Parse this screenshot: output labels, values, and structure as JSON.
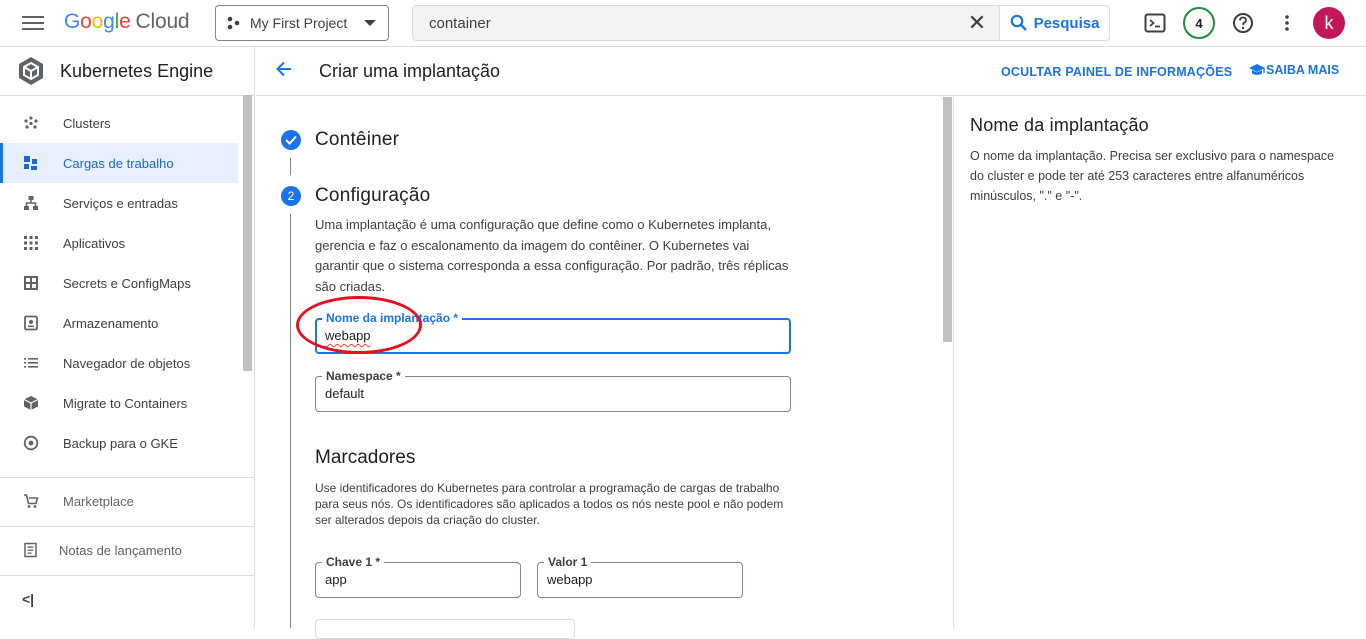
{
  "topbar": {
    "brand": {
      "g1": "G",
      "g2": "o",
      "g3": "o",
      "g4": "g",
      "g5": "l",
      "g6": "e",
      "product": "Cloud"
    },
    "project_name": "My First Project",
    "search_value": "container",
    "search_button": "Pesquisa",
    "notification_count": "4",
    "avatar_letter": "k"
  },
  "sidebar": {
    "title": "Kubernetes Engine",
    "items": [
      {
        "label": "Clusters",
        "icon": "clusters-icon"
      },
      {
        "label": "Cargas de trabalho",
        "icon": "workloads-icon"
      },
      {
        "label": "Serviços e entradas",
        "icon": "services-icon"
      },
      {
        "label": "Aplicativos",
        "icon": "applications-icon"
      },
      {
        "label": "Secrets e ConfigMaps",
        "icon": "secrets-icon"
      },
      {
        "label": "Armazenamento",
        "icon": "storage-icon"
      },
      {
        "label": "Navegador de objetos",
        "icon": "object-browser-icon"
      },
      {
        "label": "Migrate to Containers",
        "icon": "migrate-icon"
      },
      {
        "label": "Backup para o GKE",
        "icon": "backup-icon"
      }
    ],
    "marketplace": "Marketplace",
    "release_notes": "Notas de lançamento",
    "collapse": "<|"
  },
  "header": {
    "title": "Criar uma implantação",
    "hide_panel": "OCULTAR PAINEL DE INFORMAÇÕES",
    "learn_more": "SAIBA MAIS"
  },
  "steps": {
    "step1_title": "Contêiner",
    "step2_number": "2",
    "step2_title": "Configuração",
    "step2_description": "Uma implantação é uma configuração que define como o Kubernetes implanta, gerencia e faz o escalonamento da imagem do contêiner. O Kubernetes vai garantir que o sistema corresponda a essa configuração. Por padrão, três réplicas são criadas."
  },
  "form": {
    "deployment_name_label": "Nome da implantação *",
    "deployment_name_value": "webapp",
    "namespace_label": "Namespace *",
    "namespace_value": "default"
  },
  "labels_section": {
    "title": "Marcadores",
    "description": "Use identificadores do Kubernetes para controlar a programação de cargas de trabalho para seus nós. Os identificadores são aplicados a todos os nós neste pool e não podem ser alterados depois da criação do cluster.",
    "key1_label": "Chave 1 *",
    "key1_value": "app",
    "value1_label": "Valor 1",
    "value1_value": "webapp"
  },
  "info_panel": {
    "title": "Nome da implantação",
    "text": "O nome da implantação. Precisa ser exclusivo para o namespace do cluster e pode ter até 253 caracteres entre alfanuméricos minúsculos, \".\" e \"-\"."
  },
  "colors": {
    "accent": "#1a73e8",
    "annotation": "#e2131e",
    "avatar": "#c2185b"
  }
}
